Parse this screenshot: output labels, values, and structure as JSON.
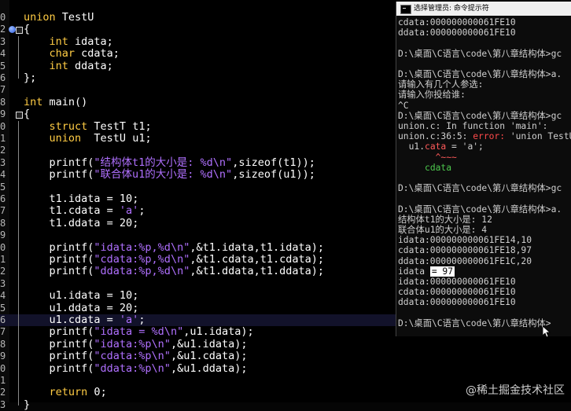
{
  "editor": {
    "lines": [
      {
        "n": "0",
        "segments": [
          {
            "c": "kw",
            "t": "union "
          },
          {
            "c": "id",
            "t": "TestU"
          }
        ]
      },
      {
        "n": "2",
        "segments": [
          {
            "c": "pn",
            "t": "{"
          }
        ]
      },
      {
        "n": "3",
        "segments": [
          {
            "c": "id",
            "t": "    "
          },
          {
            "c": "kw",
            "t": "int "
          },
          {
            "c": "id",
            "t": "idata;"
          }
        ]
      },
      {
        "n": "4",
        "segments": [
          {
            "c": "id",
            "t": "    "
          },
          {
            "c": "kw",
            "t": "char "
          },
          {
            "c": "id",
            "t": "cdata;"
          }
        ]
      },
      {
        "n": "5",
        "segments": [
          {
            "c": "id",
            "t": "    "
          },
          {
            "c": "kw",
            "t": "int "
          },
          {
            "c": "id",
            "t": "ddata;"
          }
        ]
      },
      {
        "n": "6",
        "segments": [
          {
            "c": "pn",
            "t": "};"
          }
        ]
      },
      {
        "n": "7",
        "segments": []
      },
      {
        "n": "8",
        "segments": [
          {
            "c": "kw",
            "t": "int "
          },
          {
            "c": "id",
            "t": "main()"
          }
        ]
      },
      {
        "n": "9",
        "segments": [
          {
            "c": "pn",
            "t": "{"
          }
        ]
      },
      {
        "n": "0",
        "segments": [
          {
            "c": "id",
            "t": "    "
          },
          {
            "c": "kw",
            "t": "struct "
          },
          {
            "c": "id",
            "t": "TestT t1;"
          }
        ]
      },
      {
        "n": "1",
        "segments": [
          {
            "c": "id",
            "t": "    "
          },
          {
            "c": "kw",
            "t": "union  "
          },
          {
            "c": "id",
            "t": "TestU u1;"
          }
        ]
      },
      {
        "n": "2",
        "segments": []
      },
      {
        "n": "3",
        "segments": [
          {
            "c": "id",
            "t": "    printf("
          },
          {
            "c": "str",
            "t": "\"结构体t1的大小是: %d\\n\""
          },
          {
            "c": "id",
            "t": ",sizeof(t1));"
          }
        ]
      },
      {
        "n": "4",
        "segments": [
          {
            "c": "id",
            "t": "    printf("
          },
          {
            "c": "str",
            "t": "\"联合体u1的大小是: %d\\n\""
          },
          {
            "c": "id",
            "t": ",sizeof(u1));"
          }
        ]
      },
      {
        "n": "5",
        "segments": []
      },
      {
        "n": "6",
        "segments": [
          {
            "c": "id",
            "t": "    t1.idata = "
          },
          {
            "c": "num",
            "t": "10"
          },
          {
            "c": "id",
            "t": ";"
          }
        ]
      },
      {
        "n": "7",
        "segments": [
          {
            "c": "id",
            "t": "    t1.cdata = "
          },
          {
            "c": "str",
            "t": "'a'"
          },
          {
            "c": "id",
            "t": ";"
          }
        ]
      },
      {
        "n": "8",
        "segments": [
          {
            "c": "id",
            "t": "    t1.ddata = "
          },
          {
            "c": "num",
            "t": "20"
          },
          {
            "c": "id",
            "t": ";"
          }
        ]
      },
      {
        "n": "9",
        "segments": []
      },
      {
        "n": "0",
        "segments": [
          {
            "c": "id",
            "t": "    printf("
          },
          {
            "c": "str",
            "t": "\"idata:%p,%d\\n\""
          },
          {
            "c": "id",
            "t": ",&t1.idata,t1.idata);"
          }
        ]
      },
      {
        "n": "1",
        "segments": [
          {
            "c": "id",
            "t": "    printf("
          },
          {
            "c": "str",
            "t": "\"cdata:%p,%d\\n\""
          },
          {
            "c": "id",
            "t": ",&t1.cdata,t1.cdata);"
          }
        ]
      },
      {
        "n": "2",
        "segments": [
          {
            "c": "id",
            "t": "    printf("
          },
          {
            "c": "str",
            "t": "\"ddata:%p,%d\\n\""
          },
          {
            "c": "id",
            "t": ",&t1.ddata,t1.ddata);"
          }
        ]
      },
      {
        "n": "3",
        "segments": []
      },
      {
        "n": "4",
        "segments": [
          {
            "c": "id",
            "t": "    u1.idata = "
          },
          {
            "c": "num",
            "t": "10"
          },
          {
            "c": "id",
            "t": ";"
          }
        ]
      },
      {
        "n": "5",
        "segments": [
          {
            "c": "id",
            "t": "    u1.ddata = "
          },
          {
            "c": "num",
            "t": "20"
          },
          {
            "c": "id",
            "t": ";"
          }
        ]
      },
      {
        "n": "6",
        "segments": [
          {
            "c": "id",
            "t": "    u1.cdata = "
          },
          {
            "c": "str",
            "t": "'a'"
          },
          {
            "c": "id",
            "t": ";"
          }
        ],
        "current": true
      },
      {
        "n": "7",
        "segments": [
          {
            "c": "id",
            "t": "    printf("
          },
          {
            "c": "str",
            "t": "\"idata = %d\\n\""
          },
          {
            "c": "id",
            "t": ",u1.idata);"
          }
        ]
      },
      {
        "n": "8",
        "segments": [
          {
            "c": "id",
            "t": "    printf("
          },
          {
            "c": "str",
            "t": "\"idata:%p\\n\""
          },
          {
            "c": "id",
            "t": ",&u1.idata);"
          }
        ]
      },
      {
        "n": "9",
        "segments": [
          {
            "c": "id",
            "t": "    printf("
          },
          {
            "c": "str",
            "t": "\"cdata:%p\\n\""
          },
          {
            "c": "id",
            "t": ",&u1.cdata);"
          }
        ]
      },
      {
        "n": "0",
        "segments": [
          {
            "c": "id",
            "t": "    printf("
          },
          {
            "c": "str",
            "t": "\"ddata:%p\\n\""
          },
          {
            "c": "id",
            "t": ",&u1.ddata);"
          }
        ]
      },
      {
        "n": "1",
        "segments": []
      },
      {
        "n": "2",
        "segments": [
          {
            "c": "id",
            "t": "    "
          },
          {
            "c": "kw",
            "t": "return "
          },
          {
            "c": "num",
            "t": "0"
          },
          {
            "c": "id",
            "t": ";"
          }
        ]
      },
      {
        "n": "3",
        "segments": [
          {
            "c": "pn",
            "t": "}"
          }
        ]
      }
    ]
  },
  "console": {
    "title": "选择管理员: 命令提示符",
    "lines": [
      {
        "segments": [
          {
            "c": "",
            "t": "cdata:000000000061FE10"
          }
        ]
      },
      {
        "segments": [
          {
            "c": "",
            "t": "ddata:000000000061FE10"
          }
        ]
      },
      {
        "segments": []
      },
      {
        "segments": [
          {
            "c": "",
            "t": "D:\\桌面\\C语言\\code\\第八章结构体>gc"
          }
        ]
      },
      {
        "segments": []
      },
      {
        "segments": [
          {
            "c": "",
            "t": "D:\\桌面\\C语言\\code\\第八章结构体>a."
          }
        ]
      },
      {
        "segments": [
          {
            "c": "",
            "t": "请输入有几个人参选:"
          }
        ]
      },
      {
        "segments": [
          {
            "c": "",
            "t": "请输入你投给谁:"
          }
        ]
      },
      {
        "segments": [
          {
            "c": "",
            "t": "^C"
          }
        ]
      },
      {
        "segments": [
          {
            "c": "",
            "t": "D:\\桌面\\C语言\\code\\第八章结构体>gc"
          }
        ]
      },
      {
        "segments": [
          {
            "c": "",
            "t": "union.c: In function 'main':"
          }
        ]
      },
      {
        "segments": [
          {
            "c": "",
            "t": "union.c:36:5: "
          },
          {
            "c": "err",
            "t": "error: "
          },
          {
            "c": "",
            "t": "'union TestU'"
          }
        ]
      },
      {
        "segments": [
          {
            "c": "",
            "t": "  u1."
          },
          {
            "c": "hl",
            "t": "cata"
          },
          {
            "c": "",
            "t": " = 'a';"
          }
        ]
      },
      {
        "segments": [
          {
            "c": "",
            "t": "       "
          },
          {
            "c": "hl",
            "t": "^~~~"
          }
        ]
      },
      {
        "segments": [
          {
            "c": "",
            "t": "     "
          },
          {
            "c": "grn",
            "t": "cdata"
          }
        ]
      },
      {
        "segments": []
      },
      {
        "segments": [
          {
            "c": "",
            "t": "D:\\桌面\\C语言\\code\\第八章结构体>gc"
          }
        ]
      },
      {
        "segments": []
      },
      {
        "segments": [
          {
            "c": "",
            "t": "D:\\桌面\\C语言\\code\\第八章结构体>a."
          }
        ]
      },
      {
        "segments": [
          {
            "c": "",
            "t": "结构体t1的大小是: 12"
          }
        ]
      },
      {
        "segments": [
          {
            "c": "",
            "t": "联合体u1的大小是: 4"
          }
        ]
      },
      {
        "segments": [
          {
            "c": "",
            "t": "idata:000000000061FE14,10"
          }
        ]
      },
      {
        "segments": [
          {
            "c": "",
            "t": "cdata:000000000061FE18,97"
          }
        ]
      },
      {
        "segments": [
          {
            "c": "",
            "t": "ddata:000000000061FE1C,20"
          }
        ]
      },
      {
        "segments": [
          {
            "c": "",
            "t": "idata "
          },
          {
            "c": "sel",
            "t": "= 97"
          }
        ]
      },
      {
        "segments": [
          {
            "c": "",
            "t": "idata:000000000061FE10"
          }
        ]
      },
      {
        "segments": [
          {
            "c": "",
            "t": "cdata:000000000061FE10"
          }
        ]
      },
      {
        "segments": [
          {
            "c": "",
            "t": "ddata:000000000061FE10"
          }
        ]
      },
      {
        "segments": []
      },
      {
        "segments": [
          {
            "c": "",
            "t": "D:\\桌面\\C语言\\code\\第八章结构体>"
          }
        ]
      }
    ]
  },
  "watermark": "@稀土掘金技术社区",
  "colors": {
    "keyword": "#ffcc44",
    "string": "#b070ff",
    "error": "#ff4a4a",
    "highlight_line": "#12122a"
  }
}
